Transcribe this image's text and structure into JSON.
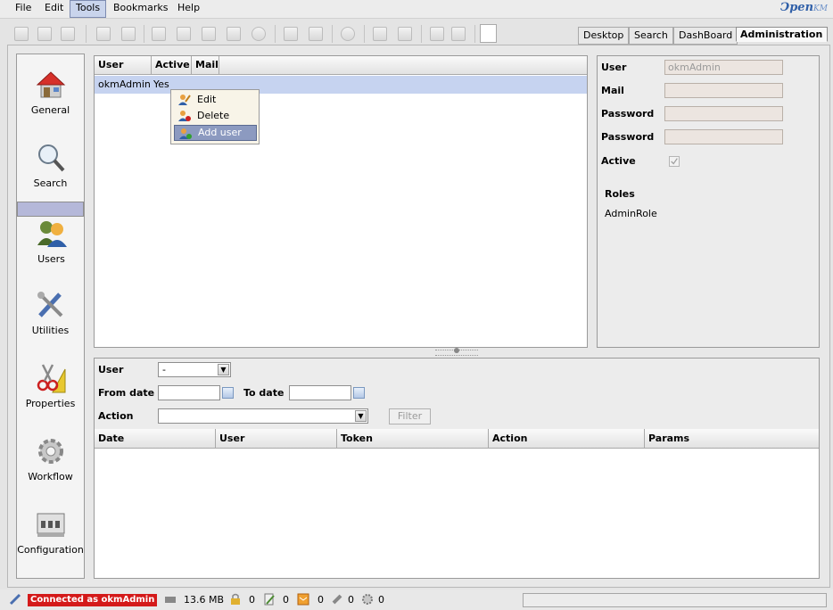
{
  "menubar": {
    "items": [
      "File",
      "Edit",
      "Tools",
      "Bookmarks",
      "Help"
    ],
    "active": "Tools"
  },
  "logo": {
    "text": "Ͻpen",
    "suffix": "KM"
  },
  "top_tabs": [
    "Desktop",
    "Search",
    "DashBoard",
    "Administration"
  ],
  "selected_tab": "Administration",
  "nav": {
    "items": [
      {
        "label": "General",
        "icon": "house-icon"
      },
      {
        "label": "Search",
        "icon": "magnifier-icon"
      },
      {
        "label": "Users",
        "icon": "users-icon"
      },
      {
        "label": "Utilities",
        "icon": "tools-icon"
      },
      {
        "label": "Properties",
        "icon": "scissors-ruler-icon"
      },
      {
        "label": "Workflow",
        "icon": "gear-icon"
      },
      {
        "label": "Configuration",
        "icon": "config-panel-icon"
      }
    ],
    "selected": "Users"
  },
  "users_table": {
    "columns": [
      "User",
      "Active",
      "Mail"
    ],
    "rows": [
      {
        "user": "okmAdmin",
        "active": "Yes",
        "mail": ""
      }
    ]
  },
  "context_menu": {
    "items": [
      "Edit",
      "Delete",
      "Add user"
    ],
    "highlighted": "Add user"
  },
  "user_detail": {
    "user_label": "User",
    "user_value": "okmAdmin",
    "mail_label": "Mail",
    "mail_value": "",
    "password_label": "Password",
    "password_confirm_label": "Password",
    "active_label": "Active",
    "active_checked": true,
    "roles_label": "Roles",
    "roles": [
      "AdminRole"
    ]
  },
  "history_filter": {
    "user_label": "User",
    "user_value": "-",
    "from_date_label": "From date",
    "to_date_label": "To date",
    "action_label": "Action",
    "filter_button": "Filter"
  },
  "history_table": {
    "columns": [
      "Date",
      "User",
      "Token",
      "Action",
      "Params"
    ]
  },
  "status": {
    "connected": "Connected as okmAdmin",
    "memory": "13.6 MB",
    "locked": "0",
    "checkout": "0",
    "news": "0",
    "subscribed": "0",
    "workflow": "0"
  },
  "colors": {
    "accent": "#b5b8d9",
    "row_selected": "#c6d3f0",
    "connected_badge": "#d41a1a",
    "menu_highlight": "#8c9ac0"
  }
}
